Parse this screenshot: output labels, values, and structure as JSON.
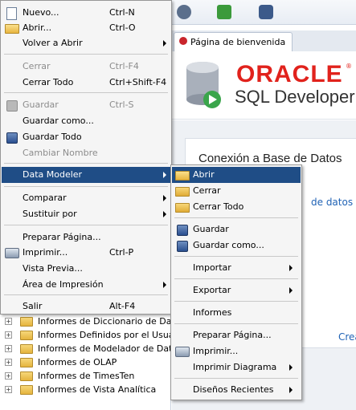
{
  "tab": {
    "label": "Página de bienvenida"
  },
  "header": {
    "brand": "ORACLE",
    "brand_mark": "®",
    "product": "SQL Developer"
  },
  "welcome": {
    "title": "Conexión a Base de Datos",
    "link1": "de datos det",
    "link2": "Crear u"
  },
  "tree": {
    "items": [
      "Informes de Diccionario de Datos",
      "Informes Definidos por el Usuario",
      "Informes de Modelador de Datos",
      "Informes de OLAP",
      "Informes de TimesTen",
      "Informes de Vista Analítica"
    ]
  },
  "file_menu": {
    "items": [
      {
        "label": "Nuevo...",
        "shortcut": "Ctrl-N",
        "icon": "new-icon"
      },
      {
        "label": "Abrir...",
        "shortcut": "Ctrl-O",
        "icon": "open-folder-icon"
      },
      {
        "label": "Volver a Abrir",
        "submenu": true
      },
      {
        "label": "Cerrar",
        "shortcut": "Ctrl-F4",
        "disabled": true
      },
      {
        "label": "Cerrar Todo",
        "shortcut": "Ctrl+Shift-F4"
      },
      {
        "label": "Guardar",
        "shortcut": "Ctrl-S",
        "disabled": true,
        "icon": "save-icon"
      },
      {
        "label": "Guardar como..."
      },
      {
        "label": "Guardar Todo",
        "icon": "save-all-icon"
      },
      {
        "label": "Cambiar Nombre",
        "disabled": true
      },
      {
        "label": "Data Modeler",
        "submenu": true,
        "selected": true
      },
      {
        "label": "Comparar",
        "submenu": true
      },
      {
        "label": "Sustituir por",
        "submenu": true
      },
      {
        "label": "Preparar Página..."
      },
      {
        "label": "Imprimir...",
        "shortcut": "Ctrl-P",
        "icon": "printer-icon"
      },
      {
        "label": "Vista Previa..."
      },
      {
        "label": "Área de Impresión",
        "submenu": true
      },
      {
        "label": "Salir",
        "shortcut": "Alt-F4"
      }
    ]
  },
  "data_modeler_menu": {
    "items": [
      {
        "label": "Abrir",
        "icon": "open-folder-icon",
        "selected": true
      },
      {
        "label": "Cerrar",
        "icon": "folder-icon"
      },
      {
        "label": "Cerrar Todo",
        "icon": "folder-icon"
      },
      {
        "label": "Guardar",
        "icon": "save-icon"
      },
      {
        "label": "Guardar como...",
        "icon": "save-as-icon"
      },
      {
        "label": "Importar",
        "submenu": true
      },
      {
        "label": "Exportar",
        "submenu": true
      },
      {
        "label": "Informes"
      },
      {
        "label": "Preparar Página..."
      },
      {
        "label": "Imprimir...",
        "icon": "printer-icon"
      },
      {
        "label": "Imprimir Diagrama",
        "submenu": true
      },
      {
        "label": "Diseños Recientes",
        "submenu": true
      }
    ]
  },
  "colors": {
    "selection": "#1f4d86",
    "oracle_red": "#e1221c",
    "link": "#1f62b5"
  }
}
